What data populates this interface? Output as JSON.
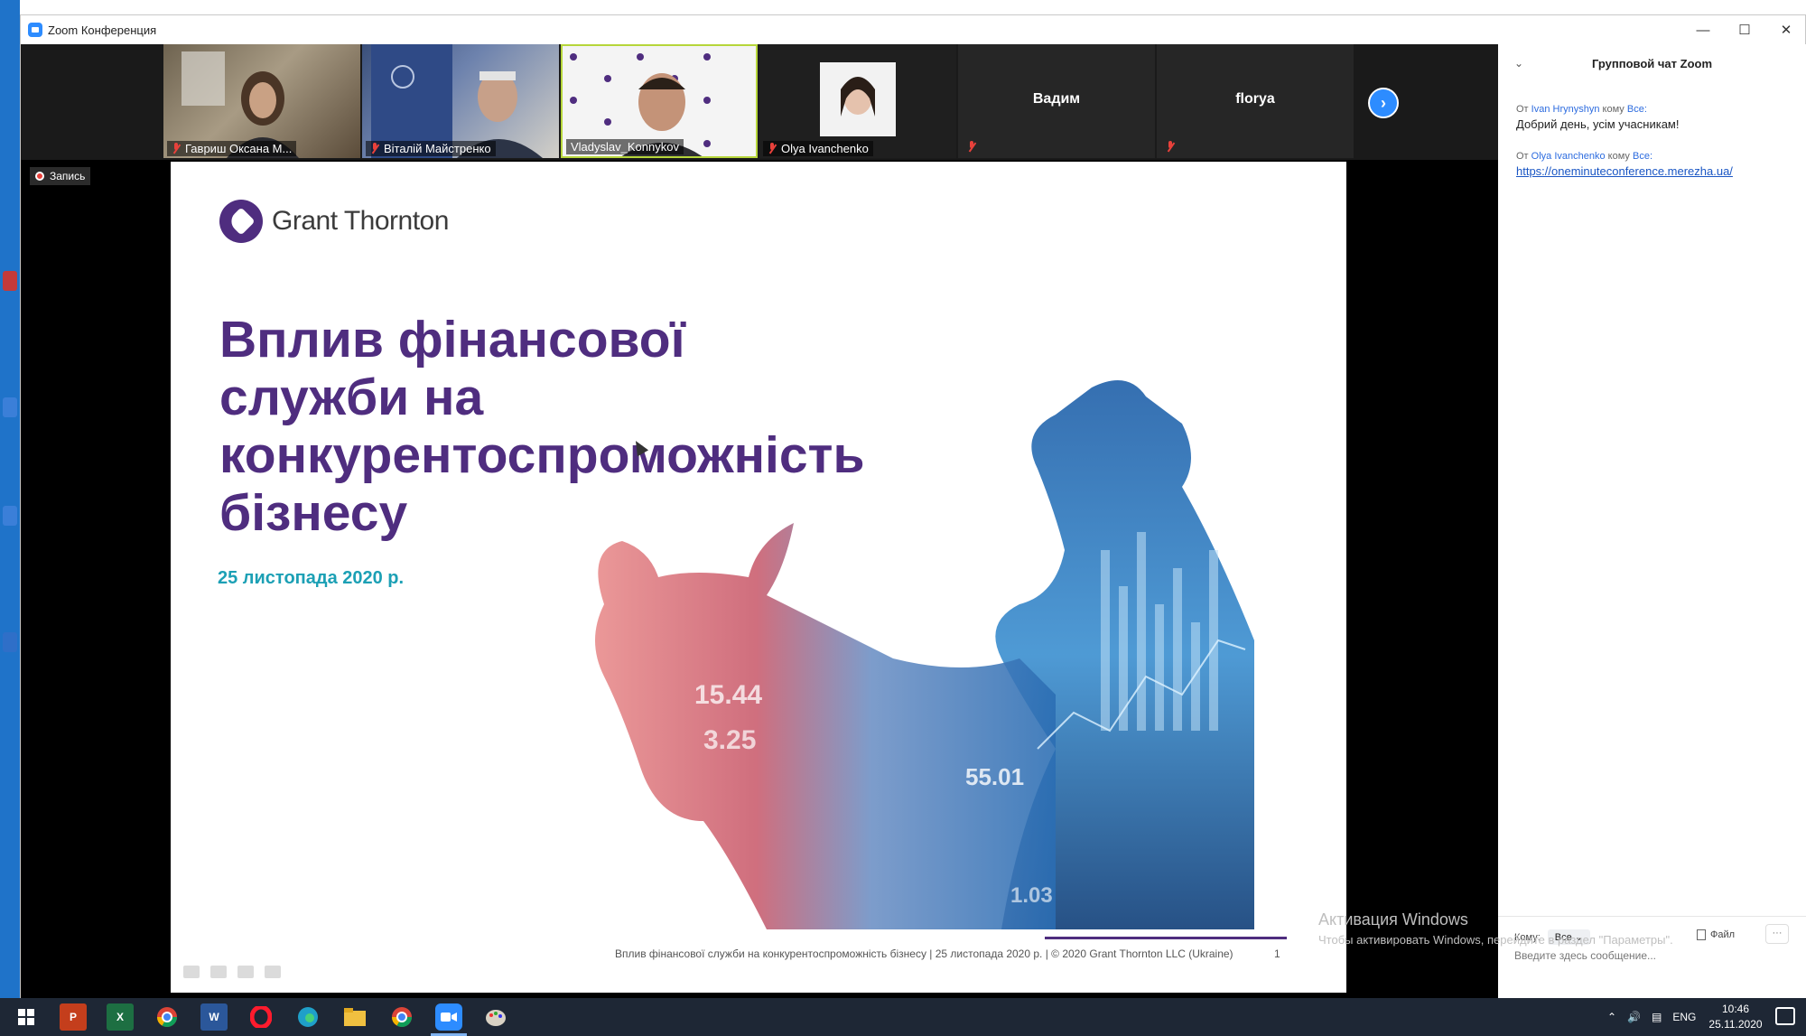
{
  "window": {
    "title": "Zoom Конференция",
    "controls": [
      "minimize",
      "maximize",
      "close"
    ]
  },
  "participants": [
    {
      "name": "Гавриш Оксана М...",
      "muted": true
    },
    {
      "name": "Віталій Майстренко",
      "muted": true
    },
    {
      "name": "Vladyslav_Konnykov",
      "muted": false
    },
    {
      "name": "Olya Ivanchenko",
      "muted": true
    },
    {
      "name": "Вадим",
      "muted": true
    },
    {
      "name": "florya",
      "muted": true
    }
  ],
  "recording": {
    "label": "Запись"
  },
  "slide": {
    "logo_text": "Grant Thornton",
    "title_lines": [
      "Вплив фінансової",
      "служби на",
      "конкурентоспроможність",
      "бізнесу"
    ],
    "date": "25 листопада  2020 р.",
    "footer": "Вплив фінансової служби на конкурентоспроможність бізнесу | 25 листопада 2020 р. | © 2020 Grant Thornton LLC (Ukraine)",
    "page_number": "1",
    "chart_numbers": [
      "15.44",
      "3.25",
      "55.01",
      "1.03"
    ]
  },
  "chat": {
    "header": "Групповой чат Zoom",
    "messages": [
      {
        "prefix": "От",
        "from": "Ivan Hrynyshyn",
        "middle": "кому",
        "to": "Все:",
        "text": "Добрий день, усім учасникам!"
      },
      {
        "prefix": "От",
        "from": "Olya Ivanchenko",
        "middle": "кому",
        "to": "Все:",
        "link": "https://oneminuteconference.merezha.ua/"
      }
    ],
    "to_label": "Кому:",
    "to_value": "Все",
    "file_label": "Файл",
    "more_label": "···",
    "input_placeholder": "Введите здесь сообщение..."
  },
  "watermark": {
    "line1": "Активация Windows",
    "line2": "Чтобы активировать Windows, перейдите в раздел \"Параметры\"."
  },
  "taskbar": {
    "apps": [
      "start-icon",
      "powerpoint-icon",
      "excel-icon",
      "chrome-icon",
      "word-icon",
      "opera-icon",
      "edge-icon",
      "file-explorer-icon",
      "chrome-icon",
      "zoom-icon",
      "paint-icon"
    ],
    "language": "ENG",
    "time": "10:46",
    "date": "25.11.2020"
  },
  "colors": {
    "accent": "#4f2d7f",
    "date_color": "#1ca0b5",
    "zoom_blue": "#2d8cff",
    "mute_red": "#e8413b",
    "taskbar": "#1e2735"
  }
}
